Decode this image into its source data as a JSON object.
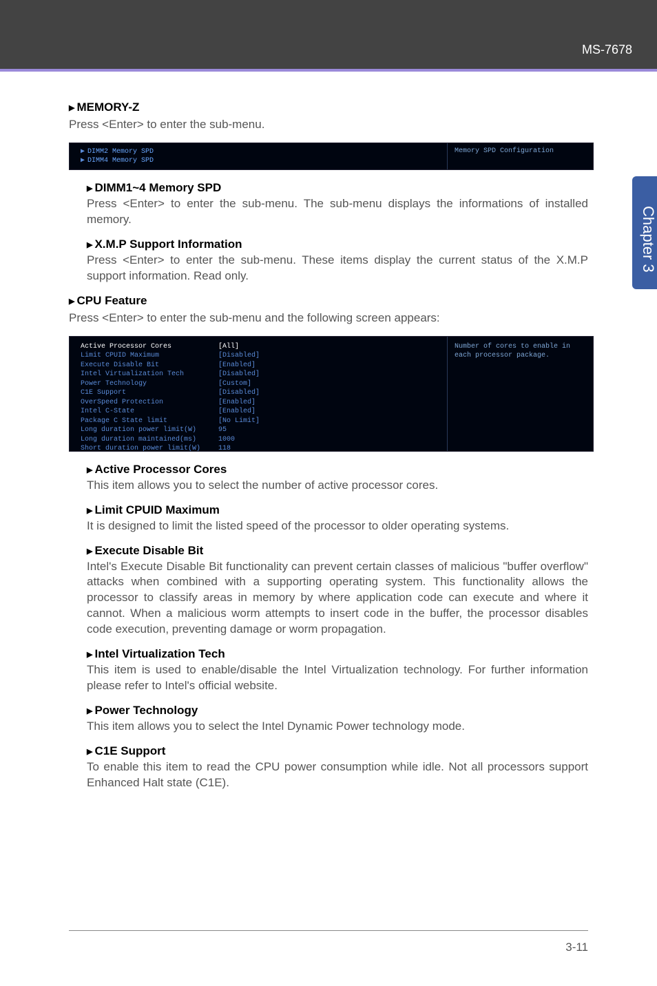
{
  "header": {
    "model": "MS-7678"
  },
  "side_tab": "Chapter 3",
  "memory_z": {
    "title": "MEMORY-Z",
    "intro": "Press <Enter> to enter the sub-menu.",
    "shot": {
      "line1": "DIMM2 Memory SPD",
      "line2": "DIMM4 Memory SPD",
      "right": "Memory SPD Configuration"
    },
    "items": [
      {
        "title": "DIMM1~4 Memory SPD",
        "body": "Press <Enter> to enter the sub-menu. The sub-menu displays the informations of installed memory."
      },
      {
        "title": "X.M.P Support Information",
        "body": "Press <Enter> to enter the sub-menu. These items display the current status of the X.M.P support information. Read only."
      }
    ]
  },
  "cpu_feature": {
    "title": "CPU Feature",
    "intro": "Press <Enter> to enter the sub-menu and the following screen appears:",
    "shot": {
      "rows": [
        {
          "label": "Active Processor Cores",
          "val": "[All]",
          "sel": true
        },
        {
          "label": "Limit CPUID Maximum",
          "val": "[Disabled]"
        },
        {
          "label": "Execute Disable Bit",
          "val": "[Enabled]"
        },
        {
          "label": "Intel Virtualization Tech",
          "val": "[Disabled]"
        },
        {
          "label": "Power Technology",
          "val": "[Custom]"
        },
        {
          "label": "C1E Support",
          "val": "[Disabled]"
        },
        {
          "label": "OverSpeed Protection",
          "val": "[Enabled]"
        },
        {
          "label": "Intel C-State",
          "val": "[Enabled]"
        },
        {
          "label": "Package C State limit",
          "val": "[No Limit]"
        },
        {
          "label": "Long duration power limit(W)",
          "val": "95"
        },
        {
          "label": "Long duration maintained(ms)",
          "val": "1000"
        },
        {
          "label": "Short duration power limit(W)",
          "val": "118"
        }
      ],
      "help": "Number of cores to enable in each processor package."
    },
    "items": [
      {
        "title": "Active Processor Cores",
        "body": "This item allows you to select the number of active processor cores."
      },
      {
        "title": "Limit CPUID Maximum",
        "body": "It is designed to limit the listed speed of the processor to older operating systems."
      },
      {
        "title": "Execute Disable Bit",
        "body": "Intel's Execute Disable Bit functionality can prevent certain classes of malicious \"buffer overflow\" attacks when combined with a supporting operating system. This functionality allows the processor to classify areas in memory by where application code can execute and where it cannot. When a malicious worm attempts to insert code in the buffer, the processor disables code execution, preventing damage or worm propagation."
      },
      {
        "title": "Intel Virtualization Tech",
        "body": "This item is used to enable/disable the Intel Virtualization technology. For further information please refer to Intel's official website."
      },
      {
        "title": "Power Technology",
        "body": "This item allows you to select the Intel Dynamic Power technology mode."
      },
      {
        "title": "C1E Support",
        "body": "To enable this item to read the CPU power consumption while idle. Not all processors support Enhanced Halt state (C1E)."
      }
    ]
  },
  "footer": {
    "page": "3-11"
  }
}
